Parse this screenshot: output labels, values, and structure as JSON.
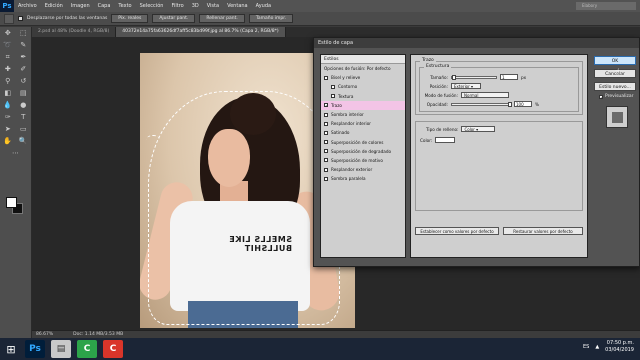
{
  "menu": {
    "logo": "Ps",
    "items": [
      "Archivo",
      "Edición",
      "Imagen",
      "Capa",
      "Texto",
      "Selección",
      "Filtro",
      "3D",
      "Vista",
      "Ventana",
      "Ayuda"
    ],
    "workspace": "Elabory"
  },
  "options": {
    "scroll_all": "Desplazarse por todas las ventanas",
    "btn_pixels": "Pix. reales",
    "btn_fit": "Ajustar pant.",
    "btn_fill": "Rellenar pant.",
    "btn_print": "Tamaño impr."
  },
  "tabs": [
    "2.psd al 48% (Doodle 4, RGB/8)",
    "40372e14a75fa63626df7aff5c83bd99f.jpg al 86.7% (Capa 2, RGB/8*)"
  ],
  "photo": {
    "shirt_text": "SMELLS LIKE BULLSHIT"
  },
  "status": {
    "zoom": "86.67%",
    "doc": "Doc: 1.14 MB/3.53 MB"
  },
  "dialog": {
    "title": "Estilo de capa",
    "styles_header": "Estilos",
    "blend_options": "Opciones de fusión: Por defecto",
    "style_items": [
      {
        "label": "Bisel y relieve",
        "checked": false
      },
      {
        "label": "Contorno",
        "checked": false
      },
      {
        "label": "Textura",
        "checked": false
      },
      {
        "label": "Trazo",
        "checked": true
      },
      {
        "label": "Sombra interior",
        "checked": false
      },
      {
        "label": "Resplandor interior",
        "checked": false
      },
      {
        "label": "Satinado",
        "checked": false
      },
      {
        "label": "Superposición de colores",
        "checked": false
      },
      {
        "label": "Superposición de degradado",
        "checked": false
      },
      {
        "label": "Superposición de motivo",
        "checked": false
      },
      {
        "label": "Resplandor exterior",
        "checked": false
      },
      {
        "label": "Sombra paralela",
        "checked": false
      }
    ],
    "stroke": {
      "group": "Trazo",
      "structure": "Estructura",
      "size_label": "Tamaño:",
      "size_value": "1",
      "size_unit": "px",
      "position_label": "Posición:",
      "position_value": "Exterior",
      "blend_label": "Modo de fusión:",
      "blend_value": "Normal",
      "opacity_label": "Opacidad:",
      "opacity_value": "100",
      "opacity_unit": "%",
      "fill_label": "Tipo de relleno:",
      "fill_value": "Color",
      "color_label": "Color:",
      "stroke_color": "#ffffff",
      "btn_default": "Establecer como valores por defecto",
      "btn_restore": "Restaurar valores por defecto"
    },
    "buttons": {
      "ok": "OK",
      "cancel": "Cancelar",
      "new_style": "Estilo nuevo...",
      "preview": "Previsualizar"
    }
  },
  "taskbar": {
    "lang": "ES",
    "time": "07:50 p.m.",
    "date": "03/04/2019"
  }
}
